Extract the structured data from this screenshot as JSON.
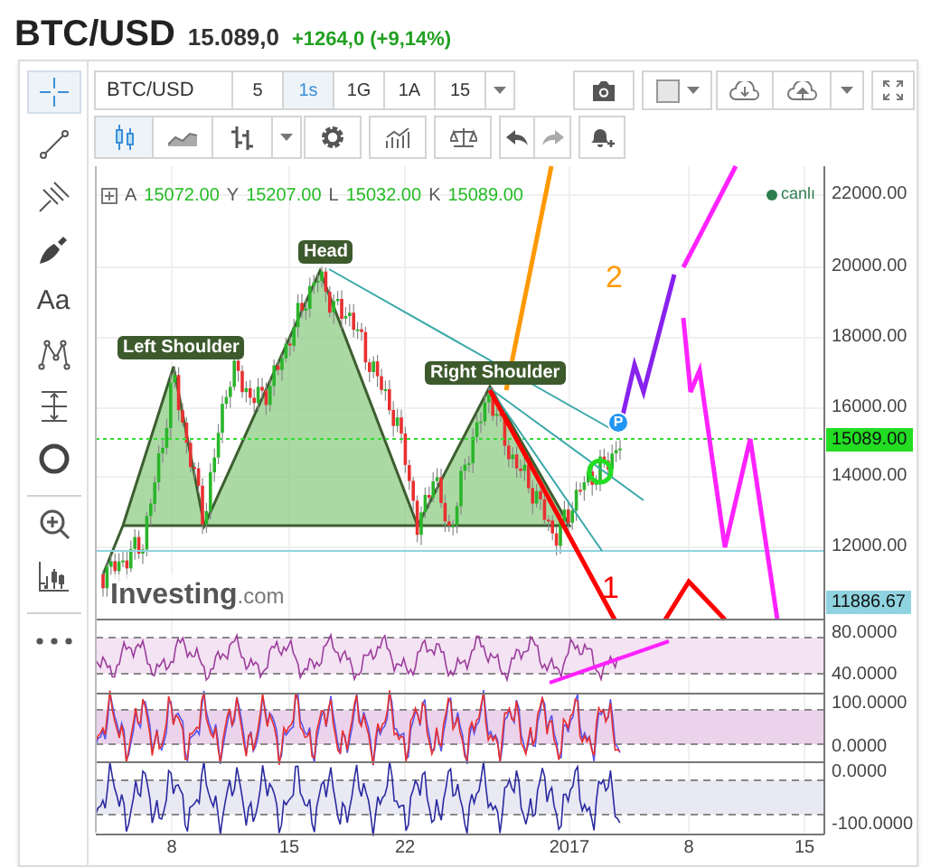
{
  "header": {
    "symbol": "BTC/USD",
    "price": "15.089,0",
    "change": "+1264,0 (+9,14%)"
  },
  "drawing_tools": [
    {
      "kind": "crosshair",
      "selected": true
    },
    {
      "kind": "line",
      "selected": false
    },
    {
      "kind": "pitchfork",
      "selected": false
    },
    {
      "kind": "brush",
      "selected": false
    },
    {
      "kind": "text",
      "label": "Aa",
      "selected": false
    },
    {
      "kind": "pattern",
      "selected": false
    },
    {
      "kind": "range",
      "selected": false
    },
    {
      "kind": "circle",
      "selected": false
    },
    {
      "kind": "zoom",
      "selected": false
    },
    {
      "kind": "measure",
      "selected": false
    },
    {
      "kind": "more",
      "selected": false
    }
  ],
  "toolbar": {
    "symbol": "BTC/USD",
    "intervals": [
      {
        "label": "5",
        "selected": false
      },
      {
        "label": "1s",
        "selected": true
      },
      {
        "label": "1G",
        "selected": false
      },
      {
        "label": "1A",
        "selected": false
      },
      {
        "label": "15",
        "selected": false
      }
    ],
    "chart_types": [
      {
        "kind": "candles",
        "selected": true
      },
      {
        "kind": "line",
        "selected": false
      },
      {
        "kind": "bars",
        "selected": false
      }
    ]
  },
  "chart": {
    "legend": [
      {
        "key": "A",
        "value": "15072.00"
      },
      {
        "key": "Y",
        "value": "15207.00"
      },
      {
        "key": "L",
        "value": "15032.00"
      },
      {
        "key": "K",
        "value": "15089.00"
      }
    ],
    "status": "canlı",
    "price_labels": [
      "22000.00",
      "20000.00",
      "18000.00",
      "16000.00",
      "14000.00",
      "12000.00"
    ],
    "current_price": "15089.00",
    "marker_price": "11886.67",
    "annotations": [
      {
        "text": "Left Shoulder"
      },
      {
        "text": "Head"
      },
      {
        "text": "Right Shoulder"
      }
    ],
    "scenarios": [
      {
        "label": "2",
        "color": "#ff9900"
      },
      {
        "label": "1",
        "color": "#ff0000"
      }
    ],
    "marker": "P",
    "logo": {
      "brand": "Investing",
      "suffix": ".com"
    }
  },
  "indicators": [
    {
      "labels": [
        "80.0000",
        "40.0000"
      ]
    },
    {
      "labels": [
        "100.0000",
        "0.0000"
      ]
    },
    {
      "labels": [
        "0.0000",
        "-100.0000"
      ]
    }
  ],
  "x_axis": [
    "8",
    "15",
    "22",
    "2017",
    "8",
    "15"
  ]
}
